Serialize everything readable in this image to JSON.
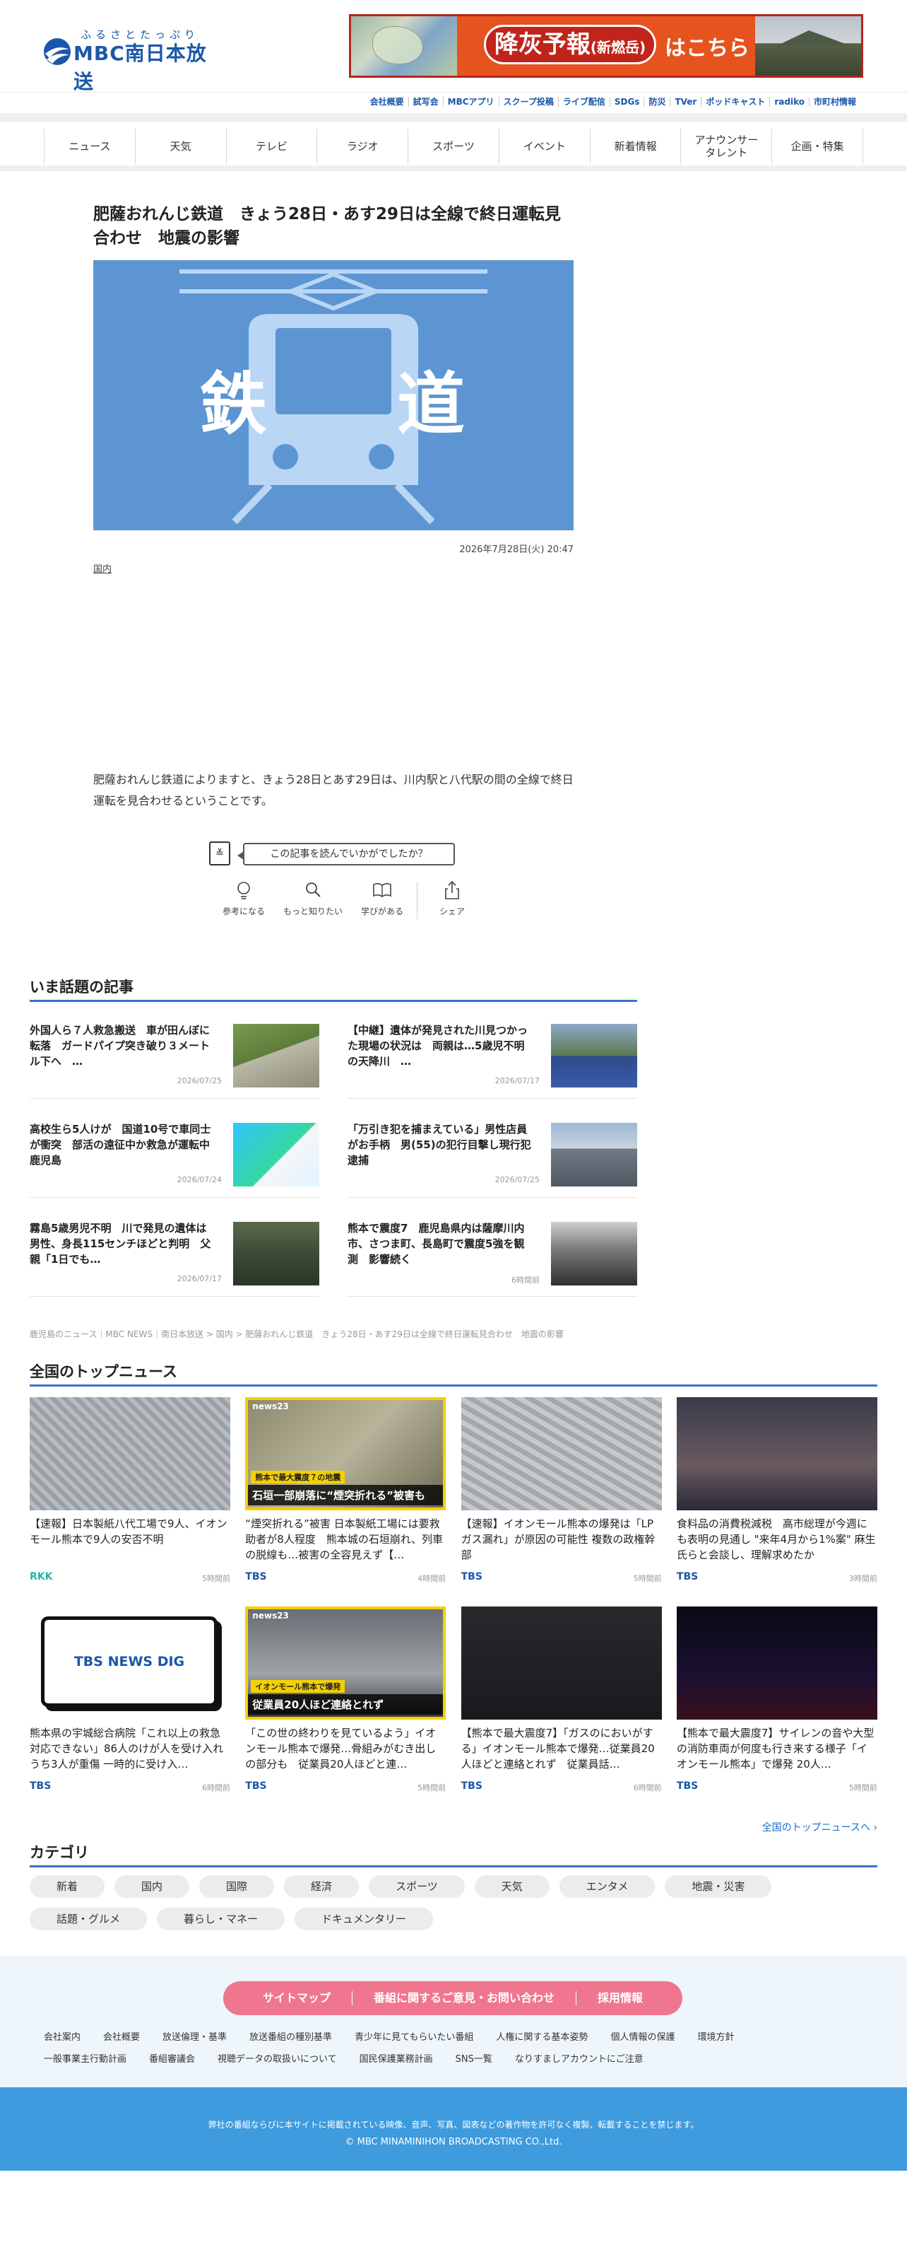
{
  "header": {
    "logo_ruby": "ふるさとたっぷり",
    "logo_text": "MBC南日本放送",
    "banner": {
      "pill_main": "降灰予報",
      "pill_sub": "(新燃岳)",
      "text": "はこちら"
    },
    "util_links": [
      "会社概要",
      "試写会",
      "MBCアプリ",
      "スクープ投稿",
      "ライブ配信",
      "SDGs",
      "防災",
      "TVer",
      "ポッドキャスト",
      "radiko",
      "市町村情報"
    ]
  },
  "nav": [
    "ニュース",
    "天気",
    "テレビ",
    "ラジオ",
    "スポーツ",
    "イベント",
    "新着情報",
    "アナウンサー\nタレント",
    "企画・特集"
  ],
  "article": {
    "title": "肥薩おれんじ鉄道　きょう28日・あす29日は全線で終日運転見合わせ　地震の影響",
    "hero_left": "鉄",
    "hero_right": "道",
    "date": "2026年7月28日(火) 20:47",
    "category": "国内",
    "body": "肥薩おれんじ鉄道によりますと、きょう28日とあす29日は、川内駅と八代駅の間の全線で終日運転を見合わせるということです。"
  },
  "feedback": {
    "question": "この記事を読んでいかがでしたか？",
    "actions": [
      "参考になる",
      "もっと知りたい",
      "学びがある",
      "シェア"
    ]
  },
  "trending": {
    "title": "いま話題の記事",
    "items": [
      {
        "title": "外国人ら７人救急搬送　車が田んぼに転落　ガードパイプ突き破り３メートル下へ　…",
        "date": "2026/07/25"
      },
      {
        "title": "【中継】遺体が発見された川見つかった現場の状況は　両親は…5歳児不明の天降川　…",
        "date": "2026/07/17"
      },
      {
        "title": "高校生ら5人けが　国道10号で車同士が衝突　部活の遠征中か救急が運転中　鹿児島",
        "date": "2026/07/24"
      },
      {
        "title": "「万引き犯を捕まえている」男性店員がお手柄　男(55)の犯行目撃し現行犯逮捕",
        "date": "2026/07/25"
      },
      {
        "title": "霧島5歳男児不明　川で発見の遺体は男性、身長115センチほどと判明　父親「1日でも…",
        "date": "2026/07/17"
      },
      {
        "title": "熊本で震度7　鹿児島県内は薩摩川内市、さつま町、長島町で震度5強を観測　影響続く",
        "date": "6時間前"
      }
    ]
  },
  "breadcrumb": "鹿児島のニュース｜MBC NEWS｜南日本放送 > 国内 > 肥薩おれんじ鉄道　きょう28日・あす29日は全線で終日運転見合わせ　地震の影響",
  "topnews": {
    "title": "全国のトップニュース",
    "items": [
      {
        "title": "【速報】日本製紙八代工場で9人、イオンモール熊本で9人の安否不明",
        "source": "RKK",
        "time": "5時間前"
      },
      {
        "title": "“煙突折れる”被害 日本製紙工場には要救助者が8人程度　熊本城の石垣崩れ、列車の脱線も…被害の全容見えず【…",
        "source": "TBS",
        "time": "4時間前"
      },
      {
        "title": "【速報】イオンモール熊本の爆発は「LPガス漏れ」が原因の可能性 複数の政権幹部",
        "source": "TBS",
        "time": "5時間前"
      },
      {
        "title": "食料品の消費税減税　高市総理が今週にも表明の見通し \"来年4月から1%案\" 麻生氏らと会談し、理解求めたか",
        "source": "TBS",
        "time": "3時間前"
      },
      {
        "title": "熊本県の宇城総合病院「これ以上の救急対応できない」86人のけが人を受け入れ うち3人が重傷 一時的に受け入…",
        "source": "TBS",
        "time": "6時間前"
      },
      {
        "title": "「この世の終わりを見ているよう」イオンモール熊本で爆発…骨組みがむき出しの部分も　従業員20人ほどと連…",
        "source": "TBS",
        "time": "5時間前"
      },
      {
        "title": "【熊本で最大震度7】「ガスのにおいがする」イオンモール熊本で爆発…従業員20人ほどと連絡とれず　従業員話…",
        "source": "TBS",
        "time": "6時間前"
      },
      {
        "title": "【熊本で最大震度7】サイレンの音や大型の消防車両が何度も行き来する様子「イオンモール熊本」で爆発 20人…",
        "source": "TBS",
        "time": "5時間前"
      }
    ],
    "thumb_texts": {
      "tbs_logo": "TBS NEWS DIG",
      "t2_badge": "熊本で最大震度７の地震",
      "t2_caption": "石垣一部崩落に“煙突折れる”被害も",
      "t6_badge": "イオンモール熊本で爆発",
      "t6_caption": "従業員20人ほど連絡とれず",
      "news23": "news23"
    },
    "more": "全国のトップニュースへ ›"
  },
  "categories": {
    "title": "カテゴリ",
    "items": [
      "新着",
      "国内",
      "国際",
      "経済",
      "スポーツ",
      "天気",
      "エンタメ",
      "地震・災害",
      "話題・グルメ",
      "暮らし・マネー",
      "ドキュメンタリー"
    ]
  },
  "footer": {
    "pill": [
      "サイトマップ",
      "番組に関するご意見・お問い合わせ",
      "採用情報"
    ],
    "links": [
      "会社案内",
      "会社概要",
      "放送倫理・基準",
      "放送番組の種別基準",
      "青少年に見てもらいたい番組",
      "人権に関する基本姿勢",
      "個人情報の保護",
      "環境方針",
      "一般事業主行動計画",
      "番組審議会",
      "視聴データの取扱いについて",
      "国民保護業務計画",
      "SNS一覧",
      "なりすましアカウントにご注意"
    ],
    "notice": "弊社の番組ならびに本サイトに掲載されている映像、音声、写真、図表などの著作物を許可なく複製、転載することを禁じます。",
    "copyright": "© MBC MINAMINIHON BROADCASTING CO.,Ltd."
  },
  "colors": {
    "brand": "#1b57a9",
    "accent_line": "#3a73c9",
    "hero_bg": "#5c95d2",
    "footer_blue": "#3d9bde",
    "pill_pink": "#f0768f",
    "banner_orange": "#e6531f"
  }
}
